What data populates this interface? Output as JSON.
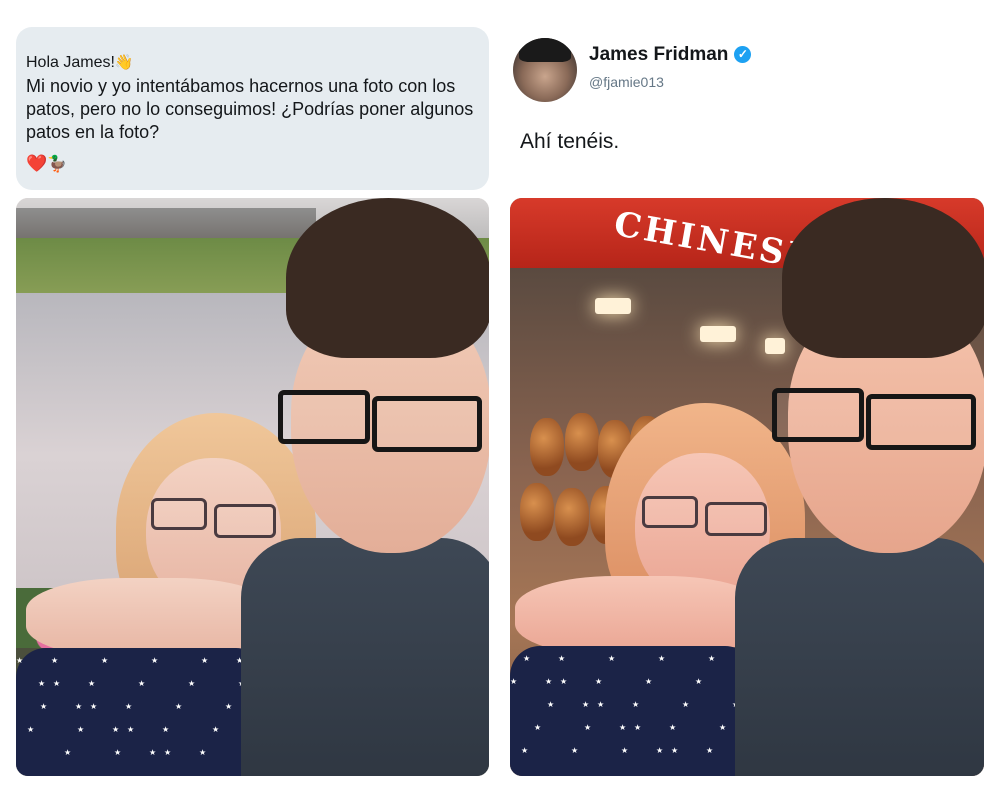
{
  "request_bubble": {
    "greeting": "Hola James!",
    "wave_emoji": "👋",
    "message": "Mi novio y yo intentábamos hacernos una foto con los patos, pero no lo conseguimos! ¿Podrías poner algunos patos en la foto?",
    "heart_emoji": "❤️",
    "duck_emoji": "🦆"
  },
  "tweet": {
    "name": "James Fridman",
    "verified_glyph": "✓",
    "handle": "@fjamie013",
    "reply": "Ahí tenéis."
  },
  "photos": {
    "after_sign_text": "CHINESE"
  },
  "colors": {
    "bubble_bg": "#e6ecf0",
    "verified": "#1da1f2",
    "text": "#14171a",
    "handle": "#657786"
  }
}
